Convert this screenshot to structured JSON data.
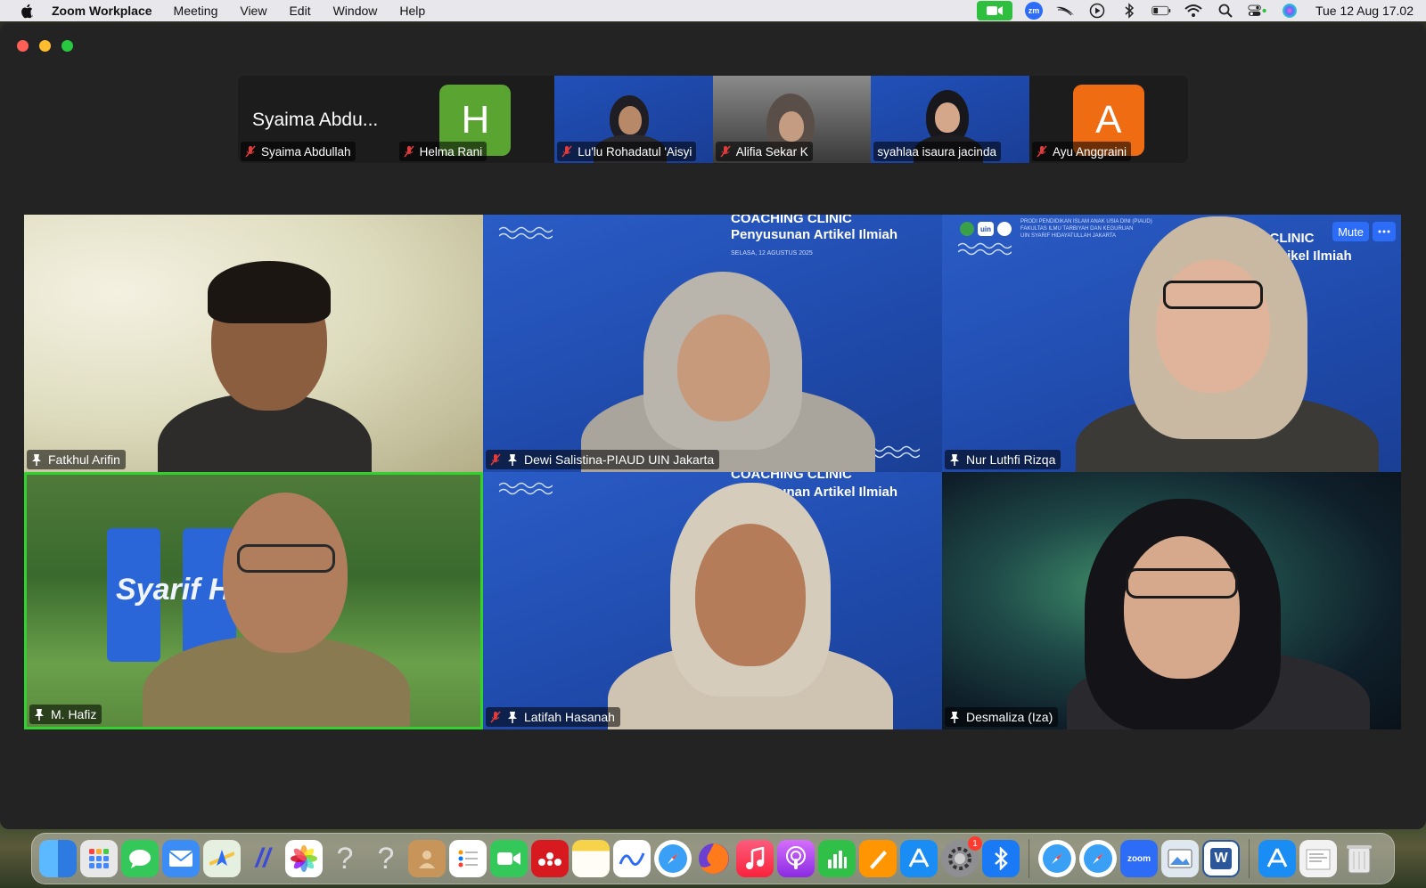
{
  "menubar": {
    "app_name": "Zoom Workplace",
    "menus": [
      "Meeting",
      "View",
      "Edit",
      "Window",
      "Help"
    ],
    "status_icons": [
      "zoom-camera-icon",
      "zoom-badge-icon",
      "wing-icon",
      "play-icon",
      "bluetooth-icon",
      "battery-icon",
      "wifi-icon",
      "search-icon",
      "control-center-icon",
      "siri-icon"
    ],
    "zm_badge": "zm",
    "clock": "Tue 12 Aug  17.02"
  },
  "filmstrip": [
    {
      "name": "Syaima Abdullah",
      "display_name": "Syaima Abdu...",
      "type": "name"
    },
    {
      "name": "Helma Rani",
      "initial": "H",
      "color": "#5aa531",
      "type": "avatar"
    },
    {
      "name": "Lu'lu Rohadatul 'Aisyi",
      "type": "video-blue"
    },
    {
      "name": "Alifia Sekar K",
      "type": "video-gray"
    },
    {
      "name": "syahlaa isaura jacinda",
      "type": "video-blue"
    },
    {
      "name": "Ayu Anggraini",
      "initial": "A",
      "color": "#ef6c12",
      "type": "avatar"
    }
  ],
  "gallery": [
    {
      "name": "Fatkhul Arifin",
      "pinned": true,
      "muted": false
    },
    {
      "name": "Dewi Salistina-PIAUD UIN Jakarta",
      "pinned": true,
      "muted": true
    },
    {
      "name": "Nur Luthfi Rizqa",
      "pinned": true,
      "muted": false
    },
    {
      "name": "M. Hafiz",
      "pinned": true,
      "muted": false,
      "active_speaker": true
    },
    {
      "name": "Latifah Hasanah",
      "pinned": true,
      "muted": true
    },
    {
      "name": "Desmaliza (Iza)",
      "pinned": true,
      "muted": false
    }
  ],
  "banner": {
    "title1": "COACHING CLINIC",
    "title2": "Penyusunan Artikel Ilmiah",
    "date": "SELASA, 12 AGUSTUS 2025",
    "title1_cropped": "CHING CLINIC",
    "title2_cropped": "unan Artikel Ilmiah",
    "sub1": "PRODI PENDIDIKAN ISLAM ANAK USIA DINI (PIAUD)",
    "sub2": "FAKULTAS ILMU TARBIYAH DAN KEGURUAN",
    "sub3": "UIN SYARIF HIDAYATULLAH JAKARTA",
    "year_fragment": "2025",
    "logo_text": "uin"
  },
  "garden_sign": "Syarif Hid",
  "tile_controls": {
    "mute_label": "Mute"
  },
  "dock": {
    "apps": [
      "finder",
      "launchpad",
      "messages",
      "mail",
      "maps",
      "notes-hash",
      "photos",
      "unknown",
      "unknown",
      "contacts",
      "reminders",
      "facetime",
      "mendeley",
      "notes",
      "freeform",
      "safari",
      "firefox",
      "music",
      "podcasts",
      "numbers",
      "pages",
      "app-store",
      "system-settings",
      "bluetooth"
    ],
    "apps2": [
      "safari-2",
      "safari-3",
      "zoom",
      "preview",
      "word"
    ],
    "apps3": [
      "app-store-2",
      "documents",
      "trash"
    ],
    "settings_badge": "1",
    "zoom_label": "zoom",
    "word_label": "W",
    "unknown_label": "?",
    "hash_label": "//"
  }
}
